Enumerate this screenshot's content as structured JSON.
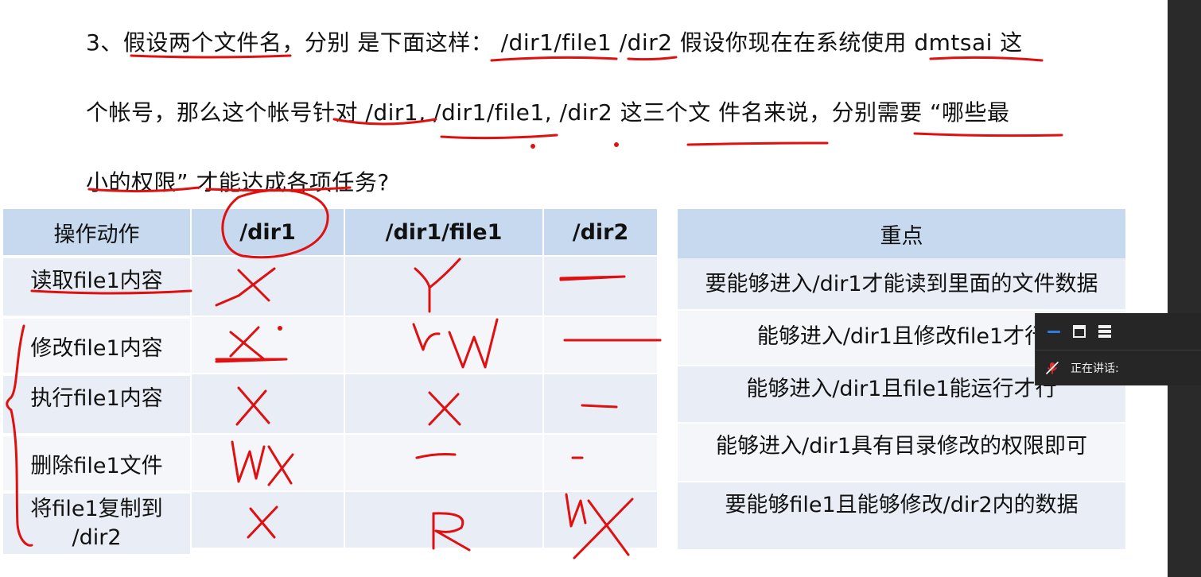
{
  "question": {
    "line1": "3、假设两个文件名，分别 是下面这样： /dir1/file1 /dir2 假设你现在在系统使用 dmtsai 这",
    "line2": "个帐号，那么这个帐号针对 /dir1, /dir1/file1, /dir2 这三个文 件名来说，分别需要 “哪些最",
    "line3": "小的权限” 才能达成各项任务?"
  },
  "table": {
    "headers": [
      "操作动作",
      "/dir1",
      "/dir1/file1",
      "/dir2"
    ],
    "rows": [
      {
        "action": "读取file1内容"
      },
      {
        "action": "修改file1内容"
      },
      {
        "action": "执行file1内容"
      },
      {
        "action": "删除file1文件"
      },
      {
        "action_line1": "将file1复制到",
        "action_line2": "/dir2"
      }
    ]
  },
  "notes": {
    "header": "重点",
    "rows": [
      "要能够进入/dir1才能读到里面的文件数据",
      "能够进入/dir1且修改file1才行",
      "能够进入/dir1且file1能运行才行",
      "能够进入/dir1具有目录修改的权限即可",
      "要能够file1且能够修改/dir2内的数据"
    ]
  },
  "handwriting": {
    "cells": [
      [
        "X",
        "Y",
        "—"
      ],
      [
        "X",
        "rw",
        "—"
      ],
      [
        "X",
        "X",
        "—"
      ],
      [
        "WX",
        "—",
        "-"
      ],
      [
        "X",
        "R",
        "WX"
      ]
    ]
  },
  "float_panel": {
    "speaking_label": "正在讲话:",
    "icons": [
      "minimize-icon",
      "window-icon",
      "menu-icon",
      "mic-muted-icon"
    ]
  },
  "colors": {
    "ink": "#e01010",
    "header_bg": "#c7d9ee",
    "panel_bg": "#262626",
    "accent": "#2d7de0"
  }
}
